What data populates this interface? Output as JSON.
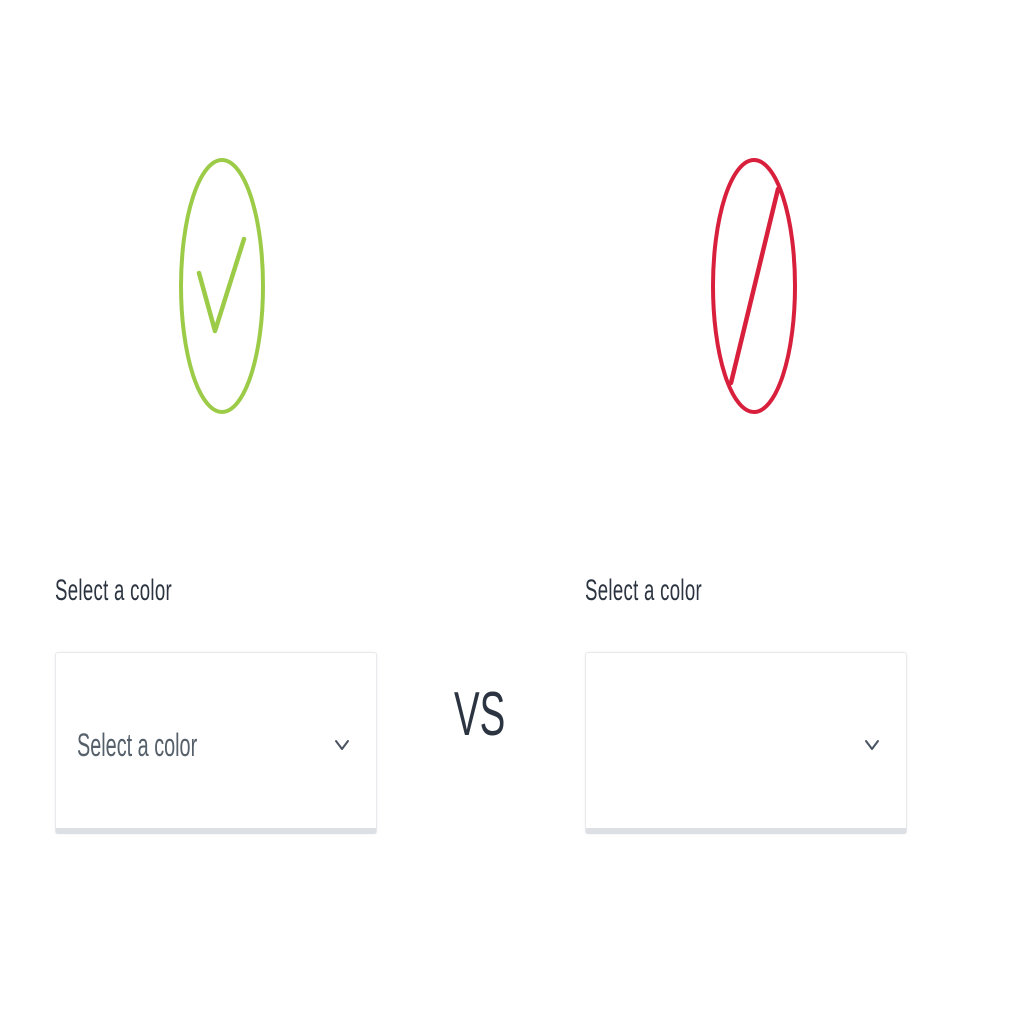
{
  "good_example": {
    "icon": "check-circle-icon",
    "color": "#9ccb48",
    "label": "Select a color",
    "select": {
      "placeholder": "Select a color",
      "chevron": "chevron-down-icon"
    }
  },
  "separator": {
    "text": "VS"
  },
  "bad_example": {
    "icon": "prohibited-circle-icon",
    "color": "#d81f3c",
    "label": "Select a color",
    "select": {
      "placeholder": "",
      "chevron": "chevron-down-icon"
    }
  }
}
